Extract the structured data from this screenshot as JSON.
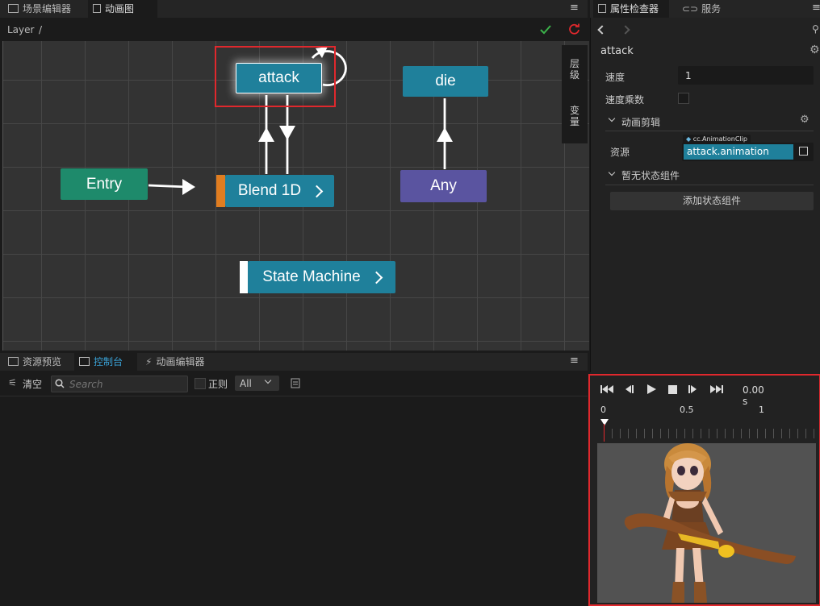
{
  "top_tabs": {
    "scene_editor": "场景编辑器",
    "anim_graph": "动画图"
  },
  "right_tabs": {
    "inspector": "属性检查器",
    "services": "服务"
  },
  "menu_icon": "≡",
  "graph": {
    "layer_label": "Layer",
    "layer_sep": "/",
    "side_tabs": {
      "layers": [
        "层",
        "级"
      ],
      "variables": [
        "变",
        "量"
      ]
    },
    "nodes": {
      "attack": "attack",
      "die": "die",
      "entry": "Entry",
      "blend": "Blend 1D",
      "any": "Any",
      "state_machine": "State Machine"
    }
  },
  "bottom_tabs": {
    "asset_preview": "资源预览",
    "console": "控制台",
    "anim_editor": "动画编辑器"
  },
  "console": {
    "clear": "清空",
    "search_placeholder": "Search",
    "regex": "正则",
    "level": "All"
  },
  "inspector": {
    "title": "attack",
    "speed_label": "速度",
    "speed_value": "1",
    "speed_mult_label": "速度乘数",
    "clip_section": "动画剪辑",
    "asset_label": "资源",
    "asset_type": "cc.AnimationClip",
    "asset_value": "attack.animation",
    "no_components": "暂无状态组件",
    "add_component": "添加状态组件"
  },
  "player": {
    "time": "0.00 s",
    "ticks": [
      "0",
      "0.5",
      "1"
    ]
  },
  "colors": {
    "accent": "#1f809b",
    "entry": "#1e8a6b",
    "any": "#5a54a0",
    "highlight": "#e0282d"
  }
}
